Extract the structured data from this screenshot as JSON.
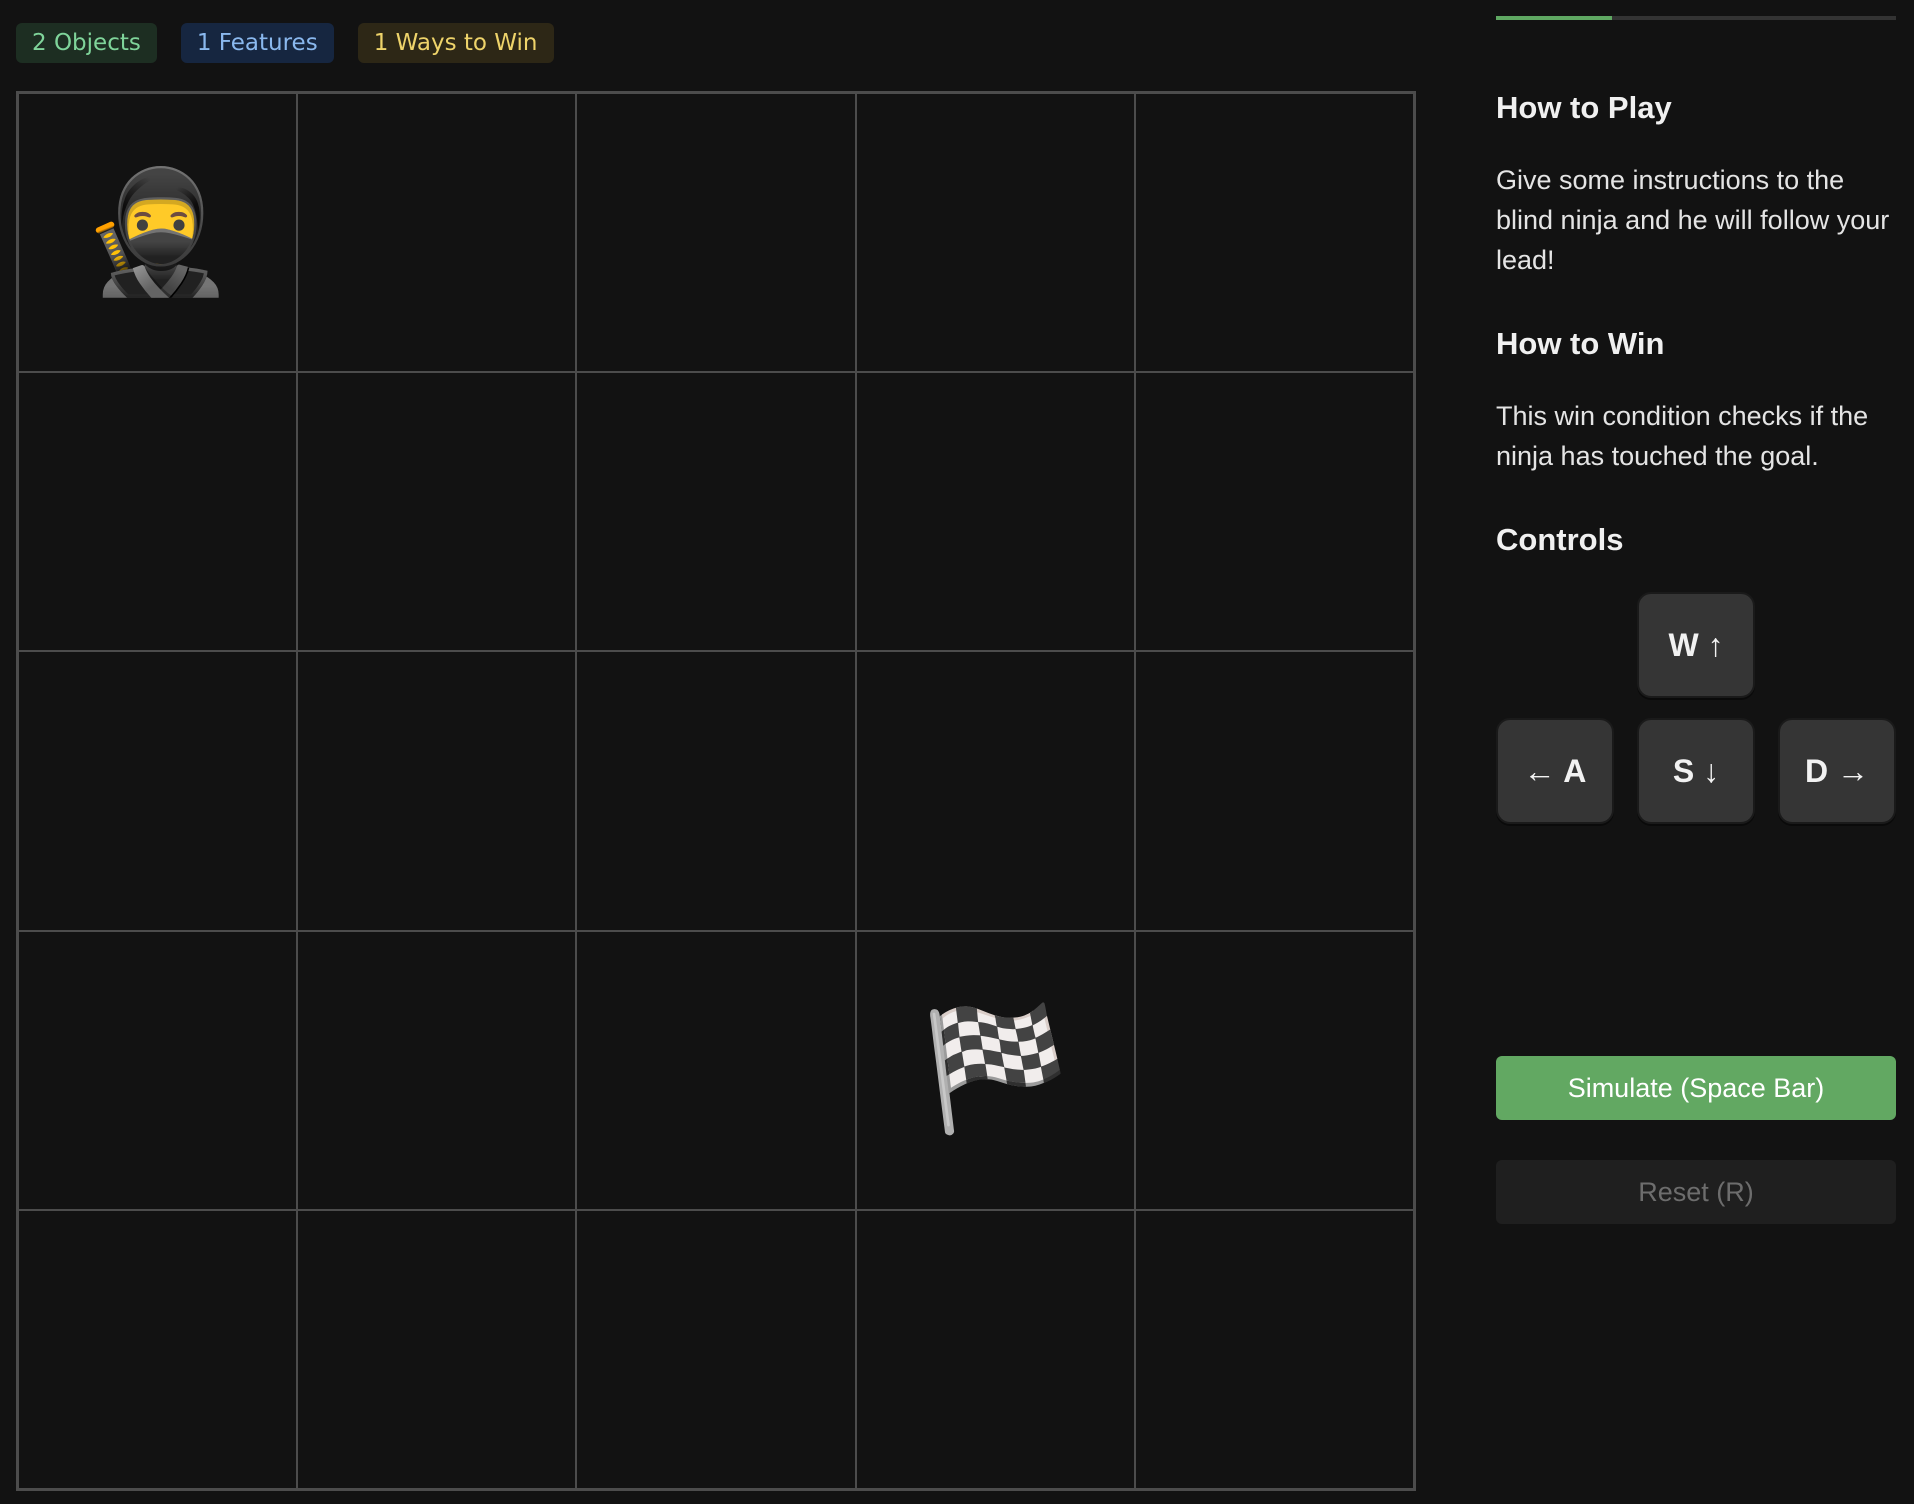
{
  "badges": {
    "objects": "2 Objects",
    "features": "1 Features",
    "ways_to_win": "1 Ways to Win"
  },
  "board": {
    "rows": 5,
    "cols": 5,
    "pieces": [
      {
        "name": "ninja",
        "glyph": "🥷",
        "row": 0,
        "col": 0
      },
      {
        "name": "goal-flag",
        "glyph": "🏁",
        "row": 3,
        "col": 3
      }
    ]
  },
  "progress": {
    "fraction": 0.29,
    "fill_color": "#5fa862"
  },
  "sidebar": {
    "how_to_play": {
      "title": "How to Play",
      "text": "Give some instructions to the blind ninja and he will follow your lead!"
    },
    "how_to_win": {
      "title": "How to Win",
      "text": "This win condition checks if the ninja has touched the goal."
    },
    "controls": {
      "title": "Controls",
      "keys": {
        "up": "W ↑",
        "left": "← A",
        "down": "S ↓",
        "right": "D →"
      }
    }
  },
  "buttons": {
    "simulate": "Simulate (Space Bar)",
    "reset": "Reset (R)"
  },
  "colors": {
    "background": "#121212",
    "simulate_button": "#62a862",
    "grid_line": "#4c4c4c"
  }
}
